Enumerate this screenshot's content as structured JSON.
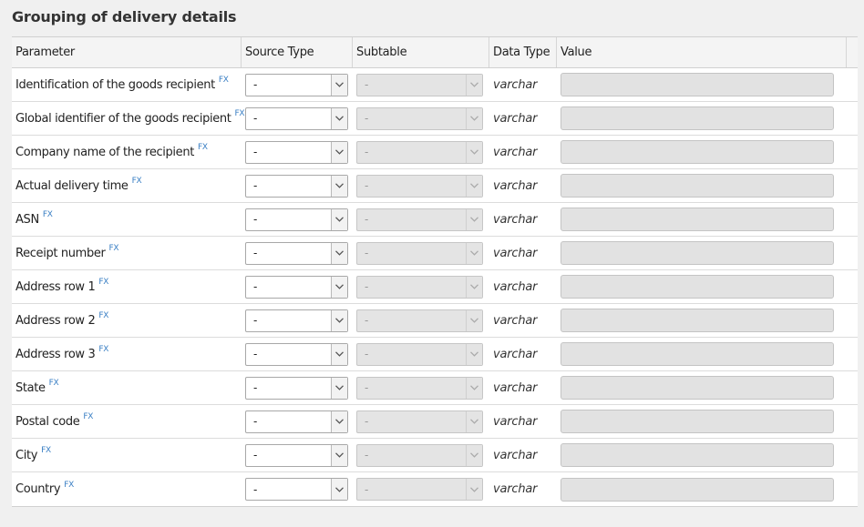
{
  "panel": {
    "title": "Grouping of delivery details"
  },
  "columns": {
    "parameter": "Parameter",
    "source_type": "Source Type",
    "subtable": "Subtable",
    "data_type": "Data Type",
    "value": "Value"
  },
  "fx_label": "FX",
  "rows": [
    {
      "parameter": "Identification of the goods recipient",
      "source_type": "-",
      "subtable": "-",
      "data_type": "varchar",
      "value": ""
    },
    {
      "parameter": "Global identifier of the goods recipient",
      "source_type": "-",
      "subtable": "-",
      "data_type": "varchar",
      "value": ""
    },
    {
      "parameter": "Company name of the recipient",
      "source_type": "-",
      "subtable": "-",
      "data_type": "varchar",
      "value": ""
    },
    {
      "parameter": "Actual delivery time",
      "source_type": "-",
      "subtable": "-",
      "data_type": "varchar",
      "value": ""
    },
    {
      "parameter": "ASN",
      "source_type": "-",
      "subtable": "-",
      "data_type": "varchar",
      "value": ""
    },
    {
      "parameter": "Receipt number",
      "source_type": "-",
      "subtable": "-",
      "data_type": "varchar",
      "value": ""
    },
    {
      "parameter": "Address row 1",
      "source_type": "-",
      "subtable": "-",
      "data_type": "varchar",
      "value": ""
    },
    {
      "parameter": "Address row 2",
      "source_type": "-",
      "subtable": "-",
      "data_type": "varchar",
      "value": ""
    },
    {
      "parameter": "Address row 3",
      "source_type": "-",
      "subtable": "-",
      "data_type": "varchar",
      "value": ""
    },
    {
      "parameter": "State",
      "source_type": "-",
      "subtable": "-",
      "data_type": "varchar",
      "value": ""
    },
    {
      "parameter": "Postal code",
      "source_type": "-",
      "subtable": "-",
      "data_type": "varchar",
      "value": ""
    },
    {
      "parameter": "City",
      "source_type": "-",
      "subtable": "-",
      "data_type": "varchar",
      "value": ""
    },
    {
      "parameter": "Country",
      "source_type": "-",
      "subtable": "-",
      "data_type": "varchar",
      "value": ""
    }
  ],
  "icons": {
    "dropdown": "chevron-down-icon"
  },
  "colors": {
    "fx_link": "#3a7fc4",
    "disabled_bg": "#e4e4e4",
    "panel_bg": "#f0f0f0"
  }
}
